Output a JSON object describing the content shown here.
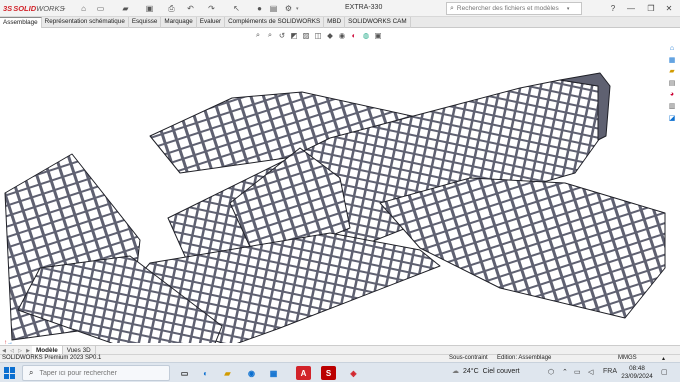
{
  "app": {
    "brand_ds": "3S",
    "brand_main": "SOLID",
    "brand_sub": "WORKS",
    "document_title": "EXTRA-330"
  },
  "titlebar": {
    "search_placeholder": "Rechercher des fichiers et modèles",
    "icons": [
      "home-icon",
      "new-file-icon",
      "open-folder-icon",
      "print-icon",
      "undo-icon",
      "select-icon",
      "rebuild-icon",
      "options-icon"
    ],
    "window_buttons": [
      "?",
      "—",
      "❐",
      "✕"
    ]
  },
  "tabs": [
    {
      "label": "Assemblage",
      "active": true
    },
    {
      "label": "Représentation schématique",
      "active": false
    },
    {
      "label": "Esquisse",
      "active": false
    },
    {
      "label": "Marquage",
      "active": false
    },
    {
      "label": "Evaluer",
      "active": false
    },
    {
      "label": "Compléments de SOLIDWORKS",
      "active": false
    },
    {
      "label": "MBD",
      "active": false
    },
    {
      "label": "SOLIDWORKS CAM",
      "active": false
    }
  ],
  "model_tabs": [
    {
      "label": "Modèle",
      "active": true
    },
    {
      "label": "Vues 3D",
      "active": false
    }
  ],
  "status": {
    "product": "SOLIDWORKS Premium 2023 SP0.1",
    "constraint": "Sous-contraint",
    "mode": "Edition: Assemblage",
    "units": "MMGS"
  },
  "taskbar": {
    "search_placeholder": "Taper ici pour rechercher",
    "temperature": "24°C",
    "weather": "Ciel couvert",
    "language": "FRA",
    "time": "08:48",
    "date": "23/09/2024"
  },
  "colors": {
    "frame_fill": "#5f6171",
    "frame_edge": "#1f2027",
    "accent": "#0b6fd0",
    "brand_red": "#d2232a"
  }
}
